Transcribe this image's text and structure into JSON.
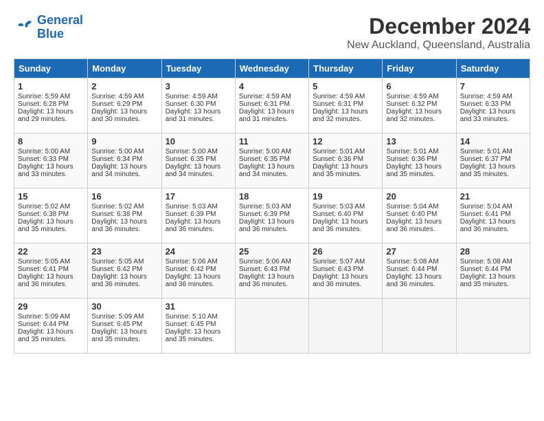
{
  "logo": {
    "line1": "General",
    "line2": "Blue"
  },
  "title": "December 2024",
  "location": "New Auckland, Queensland, Australia",
  "days_of_week": [
    "Sunday",
    "Monday",
    "Tuesday",
    "Wednesday",
    "Thursday",
    "Friday",
    "Saturday"
  ],
  "weeks": [
    [
      {
        "day": 1,
        "sunrise": "5:59 AM",
        "sunset": "6:28 PM",
        "daylight": "13 hours and 29 minutes"
      },
      {
        "day": 2,
        "sunrise": "4:59 AM",
        "sunset": "6:29 PM",
        "daylight": "13 hours and 30 minutes"
      },
      {
        "day": 3,
        "sunrise": "4:59 AM",
        "sunset": "6:30 PM",
        "daylight": "13 hours and 31 minutes"
      },
      {
        "day": 4,
        "sunrise": "4:59 AM",
        "sunset": "6:31 PM",
        "daylight": "13 hours and 31 minutes"
      },
      {
        "day": 5,
        "sunrise": "4:59 AM",
        "sunset": "6:31 PM",
        "daylight": "13 hours and 32 minutes"
      },
      {
        "day": 6,
        "sunrise": "4:59 AM",
        "sunset": "6:32 PM",
        "daylight": "13 hours and 32 minutes"
      },
      {
        "day": 7,
        "sunrise": "4:59 AM",
        "sunset": "6:33 PM",
        "daylight": "13 hours and 33 minutes"
      }
    ],
    [
      {
        "day": 8,
        "sunrise": "5:00 AM",
        "sunset": "6:33 PM",
        "daylight": "13 hours and 33 minutes"
      },
      {
        "day": 9,
        "sunrise": "5:00 AM",
        "sunset": "6:34 PM",
        "daylight": "13 hours and 34 minutes"
      },
      {
        "day": 10,
        "sunrise": "5:00 AM",
        "sunset": "6:35 PM",
        "daylight": "13 hours and 34 minutes"
      },
      {
        "day": 11,
        "sunrise": "5:00 AM",
        "sunset": "6:35 PM",
        "daylight": "13 hours and 34 minutes"
      },
      {
        "day": 12,
        "sunrise": "5:01 AM",
        "sunset": "6:36 PM",
        "daylight": "13 hours and 35 minutes"
      },
      {
        "day": 13,
        "sunrise": "5:01 AM",
        "sunset": "6:36 PM",
        "daylight": "13 hours and 35 minutes"
      },
      {
        "day": 14,
        "sunrise": "5:01 AM",
        "sunset": "6:37 PM",
        "daylight": "13 hours and 35 minutes"
      }
    ],
    [
      {
        "day": 15,
        "sunrise": "5:02 AM",
        "sunset": "6:38 PM",
        "daylight": "13 hours and 35 minutes"
      },
      {
        "day": 16,
        "sunrise": "5:02 AM",
        "sunset": "6:38 PM",
        "daylight": "13 hours and 36 minutes"
      },
      {
        "day": 17,
        "sunrise": "5:03 AM",
        "sunset": "6:39 PM",
        "daylight": "13 hours and 36 minutes"
      },
      {
        "day": 18,
        "sunrise": "5:03 AM",
        "sunset": "6:39 PM",
        "daylight": "13 hours and 36 minutes"
      },
      {
        "day": 19,
        "sunrise": "5:03 AM",
        "sunset": "6:40 PM",
        "daylight": "13 hours and 36 minutes"
      },
      {
        "day": 20,
        "sunrise": "5:04 AM",
        "sunset": "6:40 PM",
        "daylight": "13 hours and 36 minutes"
      },
      {
        "day": 21,
        "sunrise": "5:04 AM",
        "sunset": "6:41 PM",
        "daylight": "13 hours and 36 minutes"
      }
    ],
    [
      {
        "day": 22,
        "sunrise": "5:05 AM",
        "sunset": "6:41 PM",
        "daylight": "13 hours and 36 minutes"
      },
      {
        "day": 23,
        "sunrise": "5:05 AM",
        "sunset": "6:42 PM",
        "daylight": "13 hours and 36 minutes"
      },
      {
        "day": 24,
        "sunrise": "5:06 AM",
        "sunset": "6:42 PM",
        "daylight": "13 hours and 36 minutes"
      },
      {
        "day": 25,
        "sunrise": "5:06 AM",
        "sunset": "6:43 PM",
        "daylight": "13 hours and 36 minutes"
      },
      {
        "day": 26,
        "sunrise": "5:07 AM",
        "sunset": "6:43 PM",
        "daylight": "13 hours and 36 minutes"
      },
      {
        "day": 27,
        "sunrise": "5:08 AM",
        "sunset": "6:44 PM",
        "daylight": "13 hours and 36 minutes"
      },
      {
        "day": 28,
        "sunrise": "5:08 AM",
        "sunset": "6:44 PM",
        "daylight": "13 hours and 35 minutes"
      }
    ],
    [
      {
        "day": 29,
        "sunrise": "5:09 AM",
        "sunset": "6:44 PM",
        "daylight": "13 hours and 35 minutes"
      },
      {
        "day": 30,
        "sunrise": "5:09 AM",
        "sunset": "6:45 PM",
        "daylight": "13 hours and 35 minutes"
      },
      {
        "day": 31,
        "sunrise": "5:10 AM",
        "sunset": "6:45 PM",
        "daylight": "13 hours and 35 minutes"
      },
      null,
      null,
      null,
      null
    ]
  ]
}
